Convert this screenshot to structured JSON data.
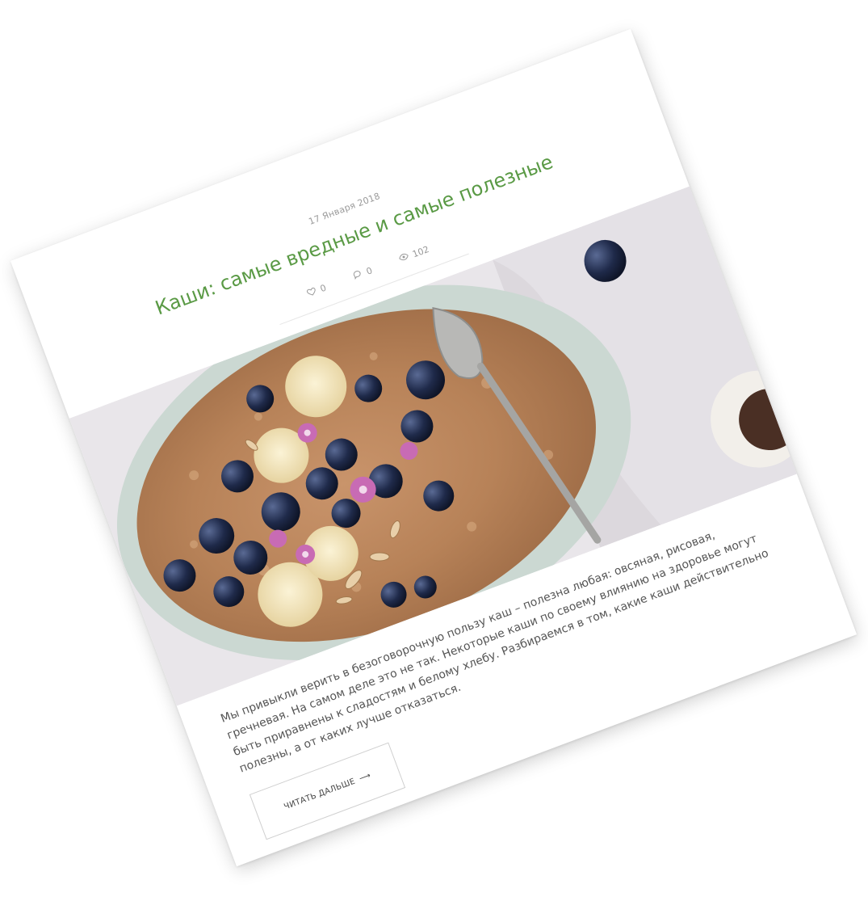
{
  "post": {
    "date": "17 Января 2018",
    "title": "Каши: самые вредные и самые полезные",
    "likes": "0",
    "comments": "0",
    "views": "102",
    "excerpt": "Мы привыкли верить в безоговорочную пользу каш – полезна любая: овсяная, рисовая, гречневая. На самом деле это не так. Некоторые каши по своему влиянию на здоровье могут быть приравнены к сладостям и белому хлебу. Разбираемся в том, какие каши действительно полезны, а от каких лучше отказаться.",
    "read_more_label": "ЧИТАТЬ ДАЛЬШЕ",
    "read_more_arrow": "⟶"
  },
  "icons": {
    "likes": "heart-icon",
    "comments": "comment-icon",
    "views": "eye-icon"
  },
  "colors": {
    "title": "#5a9a45",
    "meta": "#9a9a9a",
    "text": "#555555"
  }
}
